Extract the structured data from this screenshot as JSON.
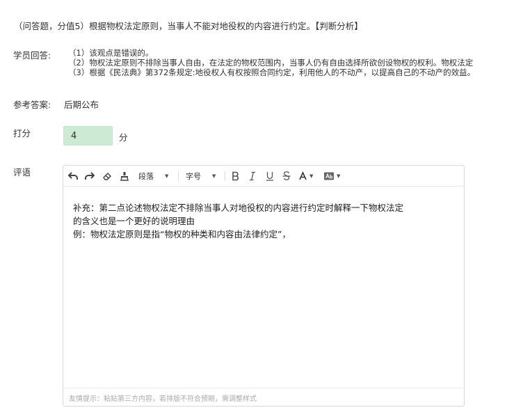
{
  "question": {
    "text": "（问答题，分值5）根据物权法定原则，当事人不能对地役权的内容进行约定。【判断分析】"
  },
  "student_answer": {
    "label": "学员回答:",
    "lines": [
      "（1）该观点是错误的。",
      "（2）物权法定原则不排除当事人自由，在法定的物权范围内，当事人仍有自由选择所欲创设物权的权利。物权法定",
      "（3）根据《民法典》第372条规定:地役权人有权按照合同约定，利用他人的不动产，以提高自己的不动产的效益。"
    ]
  },
  "reference": {
    "label": "参考答案:",
    "value": "后期公布"
  },
  "score": {
    "label": "打分",
    "value": "4",
    "unit": "分"
  },
  "comment": {
    "label": "评语",
    "toolbar": {
      "paragraph_label": "段落",
      "font_size_label": "字号"
    },
    "lines": [
      "补充：第二点论述物权法定不排除当事人对地役权的内容进行约定时解释一下物权法定",
      "的含义也是一个更好的说明理由",
      "例：物权法定原则是指“物权的种类和内容由法律约定”，"
    ],
    "hint": "友情提示：粘贴第三方内容，若排版不符合预期，需调整样式"
  },
  "icons": {
    "undo": "undo-icon",
    "redo": "redo-icon",
    "eraser": "eraser-icon",
    "brush": "format-brush-icon",
    "bold": "bold-icon",
    "italic": "italic-icon",
    "underline": "underline-icon",
    "strike": "strikethrough-icon",
    "font_color": "font-color-icon",
    "bg_color": "background-color-icon"
  },
  "colors": {
    "score_bg": "#cdebd4",
    "border": "#d9d9d9",
    "hint": "#aaaaaa"
  }
}
